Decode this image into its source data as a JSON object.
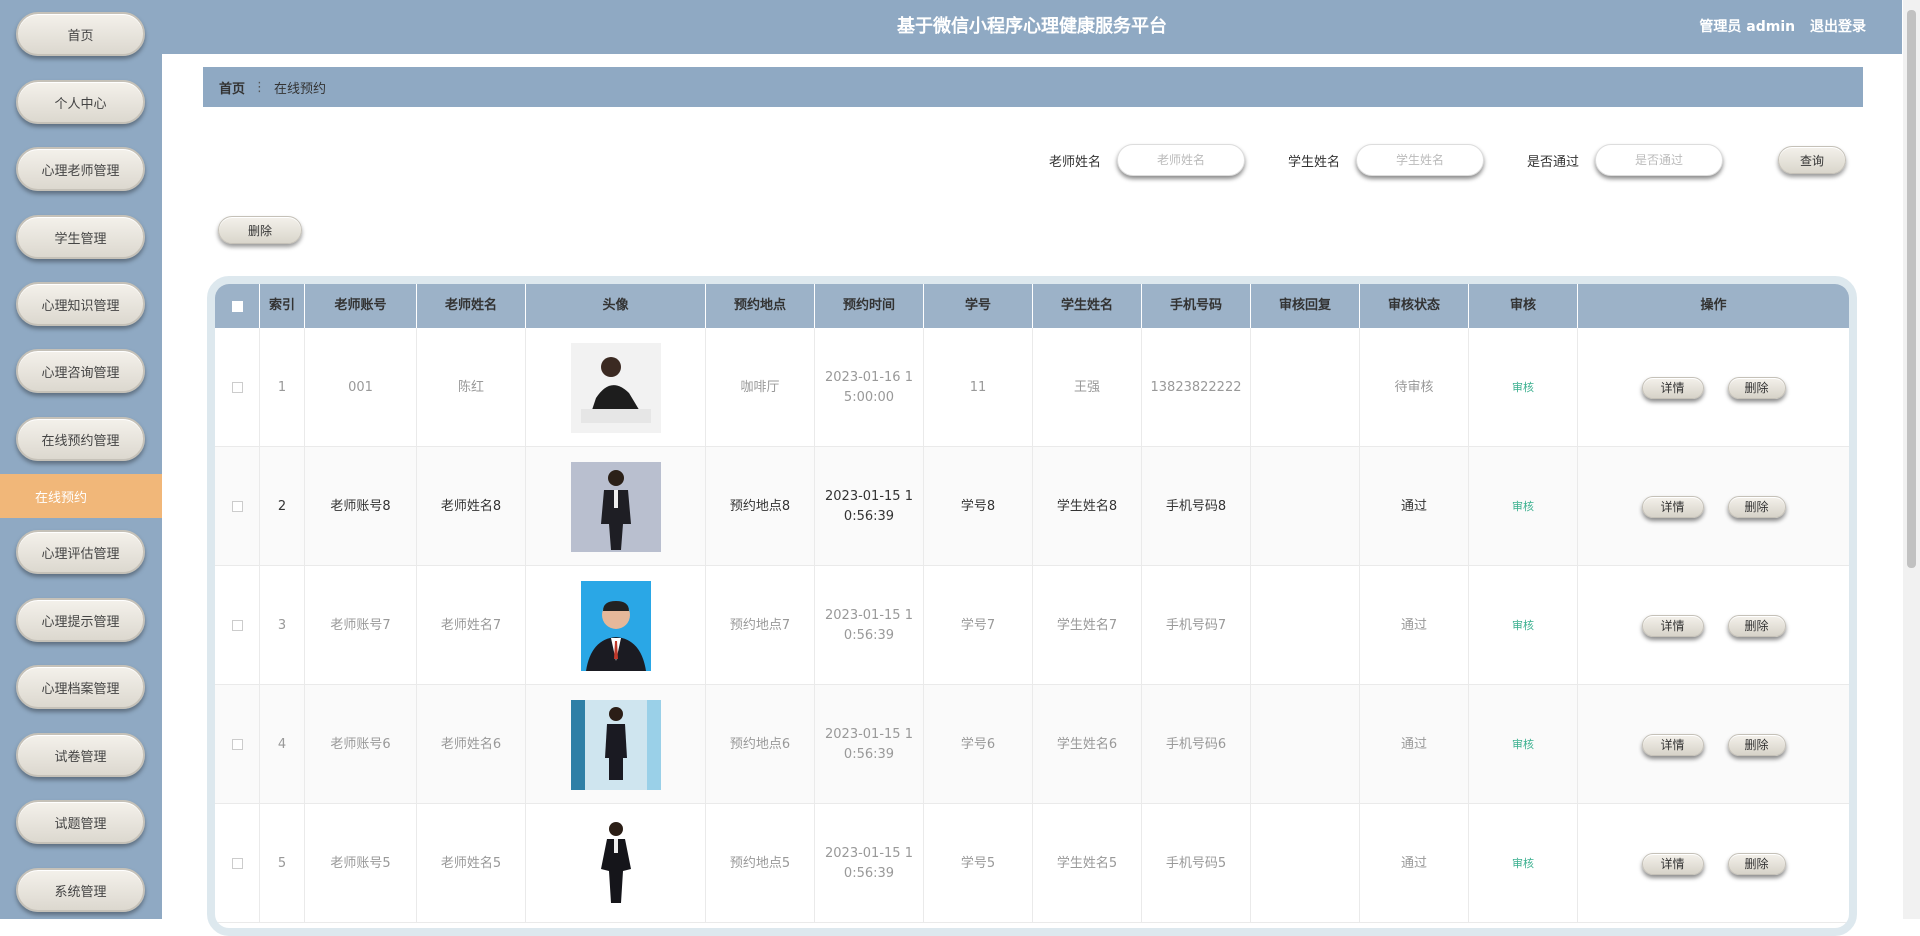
{
  "sidebar": {
    "items": [
      {
        "label": "首页"
      },
      {
        "label": "个人中心"
      },
      {
        "label": "心理老师管理"
      },
      {
        "label": "学生管理"
      },
      {
        "label": "心理知识管理"
      },
      {
        "label": "心理咨询管理"
      },
      {
        "label": "在线预约管理"
      },
      {
        "label": "心理评估管理"
      },
      {
        "label": "心理提示管理"
      },
      {
        "label": "心理档案管理"
      },
      {
        "label": "试卷管理"
      },
      {
        "label": "试题管理"
      },
      {
        "label": "系统管理"
      }
    ],
    "active_sub": "在线预约"
  },
  "header": {
    "title": "基于微信小程序心理健康服务平台",
    "user": "管理员 admin",
    "logout": "退出登录"
  },
  "breadcrumb": {
    "home": "首页",
    "sep": "⋮",
    "current": "在线预约"
  },
  "search": {
    "teacher_label": "老师姓名",
    "teacher_placeholder": "老师姓名",
    "student_label": "学生姓名",
    "student_placeholder": "学生姓名",
    "pass_label": "是否通过",
    "pass_placeholder": "是否通过",
    "query_button": "查询"
  },
  "toolbar": {
    "delete_button": "删除"
  },
  "table": {
    "headers": [
      "索引",
      "老师账号",
      "老师姓名",
      "头像",
      "预约地点",
      "预约时间",
      "学号",
      "学生姓名",
      "手机号码",
      "审核回复",
      "审核状态",
      "审核",
      "操作"
    ],
    "detail_label": "详情",
    "delete_label": "删除",
    "rows": [
      {
        "index": "1",
        "account": "001",
        "name": "陈红",
        "place": "咖啡厅",
        "time": "2023-01-16 1\n5:00:00",
        "sid": "11",
        "student": "王强",
        "phone": "13823822222",
        "reply": "",
        "status": "待审核",
        "audit": "审核"
      },
      {
        "index": "2",
        "account": "老师账号8",
        "name": "老师姓名8",
        "place": "预约地点8",
        "time": "2023-01-15 1\n0:56:39",
        "sid": "学号8",
        "student": "学生姓名8",
        "phone": "手机号码8",
        "reply": "",
        "status": "通过",
        "audit": "审核"
      },
      {
        "index": "3",
        "account": "老师账号7",
        "name": "老师姓名7",
        "place": "预约地点7",
        "time": "2023-01-15 1\n0:56:39",
        "sid": "学号7",
        "student": "学生姓名7",
        "phone": "手机号码7",
        "reply": "",
        "status": "通过",
        "audit": "审核"
      },
      {
        "index": "4",
        "account": "老师账号6",
        "name": "老师姓名6",
        "place": "预约地点6",
        "time": "2023-01-15 1\n0:56:39",
        "sid": "学号6",
        "student": "学生姓名6",
        "phone": "手机号码6",
        "reply": "",
        "status": "通过",
        "audit": "审核"
      },
      {
        "index": "5",
        "account": "老师账号5",
        "name": "老师姓名5",
        "place": "预约地点5",
        "time": "2023-01-15 1\n0:56:39",
        "sid": "学号5",
        "student": "学生姓名5",
        "phone": "手机号码5",
        "reply": "",
        "status": "通过",
        "audit": "审核"
      }
    ]
  },
  "colors": {
    "sidebar_bg": "#8fa9c3",
    "active_sub": "#f1b779",
    "table_head": "#9cb2c8",
    "audit_link": "#3bb08f"
  }
}
